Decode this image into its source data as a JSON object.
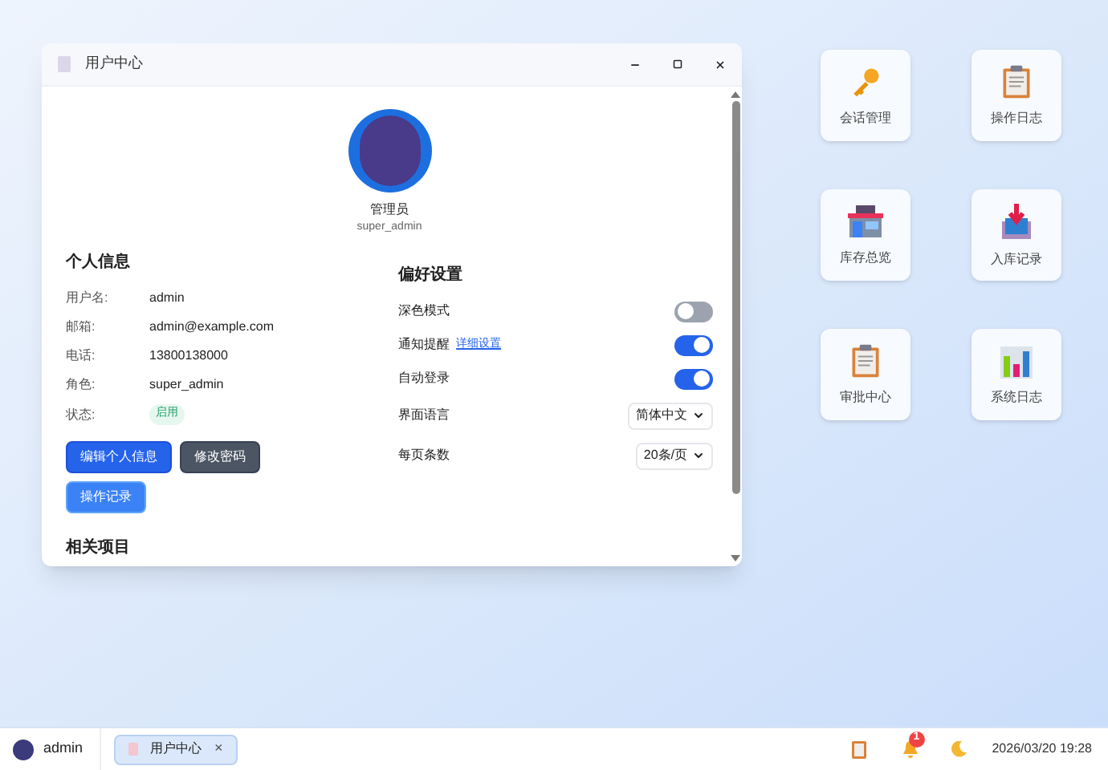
{
  "window": {
    "title": "用户中心",
    "profile": {
      "name": "管理员",
      "username": "super_admin"
    },
    "personal_info": {
      "title": "个人信息",
      "fields": [
        {
          "label": "用户名:",
          "value": "admin"
        },
        {
          "label": "邮箱:",
          "value": "admin@example.com"
        },
        {
          "label": "电话:",
          "value": "13800138000"
        },
        {
          "label": "角色:",
          "value": "super_admin"
        }
      ],
      "status": {
        "label": "状态:",
        "value": "启用"
      },
      "buttons": [
        {
          "label": "编辑个人信息",
          "kind": "primary"
        },
        {
          "label": "修改密码",
          "kind": "dark"
        },
        {
          "label": "操作记录",
          "kind": "light"
        }
      ]
    },
    "preferences": {
      "title": "偏好设置",
      "items": [
        {
          "kind": "toggle",
          "label": "深色模式",
          "on": false
        },
        {
          "kind": "toggle",
          "label": "通知提醒",
          "link": "详细设置",
          "on": true
        },
        {
          "kind": "toggle",
          "label": "自动登录",
          "on": true
        },
        {
          "kind": "select",
          "label": "界面语言",
          "value": "简体中文"
        },
        {
          "kind": "select",
          "label": "每页条数",
          "value": "20条/页"
        }
      ]
    },
    "related_title": "相关项目"
  },
  "desktop_icons": [
    {
      "label": "会话管理",
      "kind": "key"
    },
    {
      "label": "操作日志",
      "kind": "clipboard"
    },
    {
      "label": "库存总览",
      "kind": "store"
    },
    {
      "label": "入库记录",
      "kind": "inbox"
    },
    {
      "label": "审批中心",
      "kind": "clipboard"
    },
    {
      "label": "系统日志",
      "kind": "chart"
    }
  ],
  "taskbar": {
    "user": "admin",
    "tasks": [
      {
        "label": "用户中心",
        "close": "×",
        "selected": true
      }
    ],
    "notification_count": "1",
    "clock": "2026/03/20 19:28"
  }
}
